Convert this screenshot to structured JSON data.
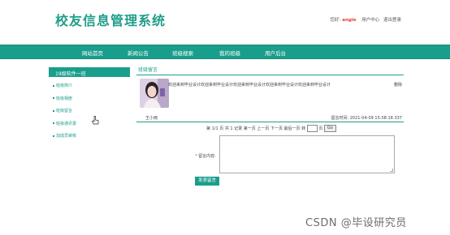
{
  "header": {
    "logo": "校友信息管理系统",
    "welcome": "您好:",
    "username": "angle",
    "links": [
      "用户中心",
      "退出登录"
    ]
  },
  "nav": {
    "items": [
      "网站首页",
      "新闻公告",
      "班级搜索",
      "我的班级",
      "用户后台"
    ]
  },
  "sidebar": {
    "title": "19级软件一班",
    "items": [
      "班级简介",
      "班级相册",
      "班级留言",
      "班级通讯录",
      "加成员审核"
    ]
  },
  "main": {
    "section_title": "班级留言",
    "message": {
      "text": "欢迎来到毕业设计欢迎来到毕业设计欢迎来到毕业设计欢迎来到毕业设计欢迎来到毕业设计",
      "delete_label": "删除",
      "author": "王小雨",
      "time_label": "留言时间:",
      "time": "2021-04-09 15:08:18.337"
    },
    "pager": {
      "summary": "第 1/1 页 共 1 记录 第一页 上一页 下一页 最后一页 转",
      "page_suffix": "页",
      "go": "Go"
    },
    "form": {
      "required_mark": "*",
      "label": "留言内容:",
      "submit": "发表留言"
    }
  },
  "watermark": "CSDN @毕设研究员",
  "colors": {
    "accent": "#1a9e8c",
    "logo": "#1f9d8a",
    "username": "#e53935"
  }
}
